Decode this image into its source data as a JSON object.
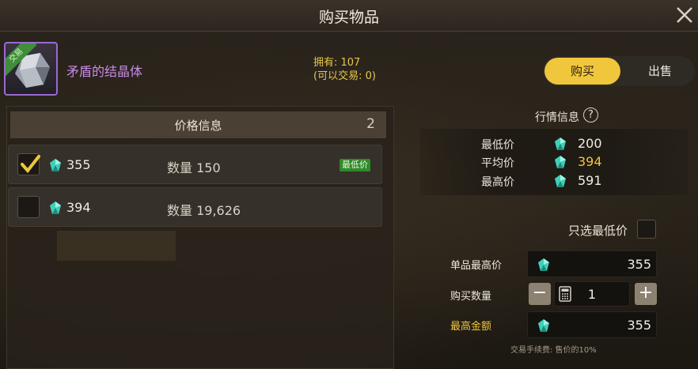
{
  "dialog": {
    "title": "购买物品"
  },
  "item": {
    "name": "矛盾的结晶体",
    "tag": "交易",
    "owned_line": "拥有: 107",
    "tradable_line": "(可以交易: 0)"
  },
  "mode_toggle": {
    "buy": "购买",
    "sell": "出售",
    "selected": "buy"
  },
  "price_list": {
    "header": "价格信息",
    "count": "2",
    "rows": [
      {
        "price": "355",
        "qty_label": "数量",
        "qty": "150",
        "badge": "最低价",
        "checked": true
      },
      {
        "price": "394",
        "qty_label": "数量",
        "qty": "19,626",
        "badge": "",
        "checked": false
      }
    ]
  },
  "market": {
    "title": "行情信息",
    "help": "?",
    "rows": [
      {
        "label": "最低价",
        "value": "200"
      },
      {
        "label": "平均价",
        "value": "394"
      },
      {
        "label": "最高价",
        "value": "591"
      }
    ]
  },
  "form": {
    "lowest_only_label": "只选最低价",
    "unit_max_label": "单品最高价",
    "unit_max_value": "355",
    "qty_label": "购买数量",
    "qty_value": "1",
    "total_label": "最高金额",
    "total_value": "355",
    "fee_note": "交易手续费: 售价的10%"
  },
  "colors": {
    "accent": "#f0c63c",
    "item_name": "#c98be8",
    "badge": "#2f8a2a",
    "gem": "#3fd0b8"
  },
  "icons": [
    "close-icon",
    "gem-icon",
    "check-icon",
    "help-icon",
    "minus-icon",
    "plus-icon",
    "calculator-icon"
  ]
}
